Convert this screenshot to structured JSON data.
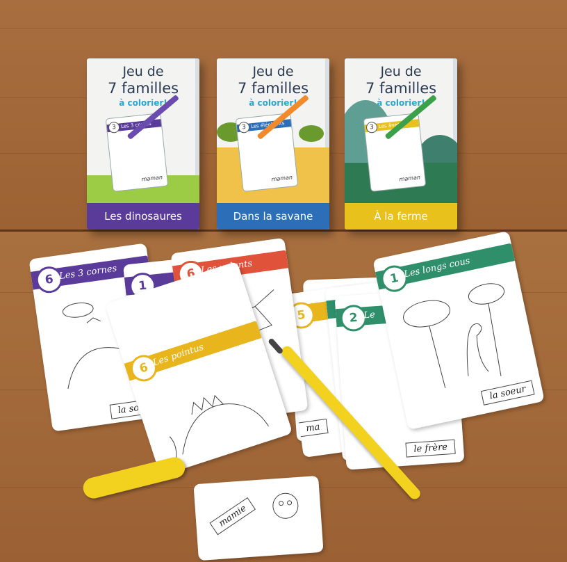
{
  "boxes": [
    {
      "line1": "Jeu de",
      "line2": "7 familles",
      "sub": "à colorier!",
      "card_number": "3",
      "card_family": "Les 3 cornes",
      "signature": "maman",
      "label": "Les dinosaures",
      "label_color": "#5a3b9a",
      "ground_color": "#9ccb45",
      "sky_color": "#f3f4f2"
    },
    {
      "line1": "Jeu de",
      "line2": "7 familles",
      "sub": "à colorier!",
      "card_number": "3",
      "card_family": "Les éléphants",
      "signature": "maman",
      "label": "Dans la savane",
      "label_color": "#2c6fb8",
      "ground_color": "#f0c24a",
      "sky_color": "#f3f4f2"
    },
    {
      "line1": "Jeu de",
      "line2": "7 familles",
      "sub": "à colorier!",
      "card_number": "3",
      "card_family": "Les ânes",
      "signature": "maman",
      "label": "À la ferme",
      "label_color": "#e8c11c",
      "ground_color": "#2e7a52",
      "sky_color": "#f3f4f2"
    }
  ],
  "cards": [
    {
      "number": "6",
      "family": "Les 3 cornes",
      "role": "la sœur",
      "color": "#5a3b9a"
    },
    {
      "number": "1",
      "family": "",
      "role": "",
      "color": "#5a3b9a"
    },
    {
      "number": "6",
      "family": "Les volants",
      "role": "",
      "color": "#e0533a"
    },
    {
      "number": "6",
      "family": "Les pointus",
      "role": "",
      "color": "#e8b51d"
    },
    {
      "number": "5",
      "family": "",
      "role": "ma",
      "color": "#e8b51d"
    },
    {
      "number": "2",
      "family": "Le",
      "role": "",
      "color": "#2e8f6a"
    },
    {
      "number": "1",
      "family": "Les longs cous",
      "role": "la soeur",
      "color": "#2e8f6a"
    },
    {
      "number": "",
      "family": "",
      "role": "le frère",
      "color": "#2e8f6a"
    },
    {
      "number": "",
      "family": "",
      "role": "mamie",
      "color": "#999999"
    }
  ],
  "colors": {
    "wood": "#a2683a",
    "wood_dark": "#7d4a26",
    "marker": "#f2d21e"
  }
}
